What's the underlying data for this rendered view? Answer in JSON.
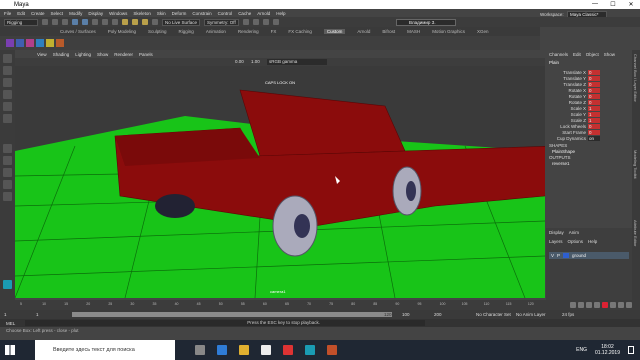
{
  "window": {
    "title": "Maya",
    "controls": [
      "—",
      "☐",
      "✕"
    ]
  },
  "menu": [
    "File",
    "Edit",
    "Create",
    "Select",
    "Modify",
    "Display",
    "Windows",
    "Skeleton",
    "Skin",
    "Deform",
    "Constrain",
    "Control",
    "Cache",
    "Arnold",
    "Help"
  ],
  "statusline": {
    "mode": "Rigging",
    "snap_field": "No Live Surface",
    "symmetry": "Symmetry: Off",
    "user": "Владимир З."
  },
  "workspace": {
    "label": "Workspace:",
    "value": "Maya Classic*"
  },
  "shelf_tabs": [
    "Curves / Surfaces",
    "Poly Modeling",
    "Sculpting",
    "Rigging",
    "Animation",
    "Rendering",
    "FX",
    "FX Caching",
    "Custom",
    "Arnold",
    "Bifrost",
    "MASH",
    "Motion Graphics",
    "XGen"
  ],
  "shelf_active": "Custom",
  "viewport_menu": [
    "View",
    "Shading",
    "Lighting",
    "Show",
    "Renderer",
    "Panels"
  ],
  "viewport_toolbar": {
    "exposure": "0.00",
    "gamma": "1.00",
    "colorspace": "sRGB gamma"
  },
  "viewport": {
    "caps_warning": "CAPS LOCK ON",
    "camera": "camera1"
  },
  "channel_box": {
    "tabs": [
      "Channels",
      "Edit",
      "Object",
      "Show"
    ],
    "object": "Plain",
    "channels": [
      {
        "name": "Translate X",
        "value": "0",
        "keyed": true
      },
      {
        "name": "Translate Y",
        "value": "0",
        "keyed": true
      },
      {
        "name": "Translate Z",
        "value": "0",
        "keyed": true
      },
      {
        "name": "Rotate X",
        "value": "0",
        "keyed": true
      },
      {
        "name": "Rotate Y",
        "value": "0",
        "keyed": true
      },
      {
        "name": "Rotate Z",
        "value": "0",
        "keyed": true
      },
      {
        "name": "Scale X",
        "value": "1",
        "keyed": true
      },
      {
        "name": "Scale Y",
        "value": "1",
        "keyed": true
      },
      {
        "name": "Scale Z",
        "value": "1",
        "keyed": true
      },
      {
        "name": "Lock Wheels",
        "value": "0",
        "keyed": true
      },
      {
        "name": "Start Frame",
        "value": "0",
        "keyed": true
      },
      {
        "name": "Cup Dynamics",
        "value": "on",
        "keyed": false
      }
    ],
    "shapes_header": "SHAPES",
    "shape": "PlainShape",
    "outputs_header": "OUTPUTS",
    "output": "reverse1"
  },
  "layer_editor": {
    "tabs": [
      "Display",
      "Anim"
    ],
    "menu": [
      "Layers",
      "Options",
      "Help"
    ],
    "layer": {
      "flags": [
        "V",
        "P"
      ],
      "name": "ground"
    }
  },
  "attr_strip": [
    "Channel Box / Layer Editor",
    "Modeling Toolkit",
    "Attribute Editor"
  ],
  "timeline": {
    "ticks": [
      "5",
      "10",
      "15",
      "20",
      "25",
      "30",
      "35",
      "40",
      "45",
      "50",
      "55",
      "60",
      "65",
      "70",
      "75",
      "80",
      "85",
      "90",
      "95",
      "100",
      "105",
      "110",
      "115",
      "120"
    ]
  },
  "range": {
    "start": "1",
    "inner_start": "1",
    "inner_end": "120",
    "end_a": "100",
    "end_b": "200",
    "character": "No Character Set",
    "anim_layer": "No Anim Layer",
    "fps": "24 fps"
  },
  "mel": {
    "label": "MEL",
    "help": "Press the ESC key to stop playback."
  },
  "help_line": "Choose Box: Left press - close - plut",
  "taskbar": {
    "search": "Введите здесь текст для поиска",
    "lang": "ENG",
    "time": "18:02",
    "date": "01.12.2019"
  },
  "colors": {
    "car_body": "#8b0c0c",
    "ground": "#18c418",
    "grid": "#0b6e0b",
    "key_red": "#c43030",
    "shelf_active": "#5d5d5d"
  }
}
